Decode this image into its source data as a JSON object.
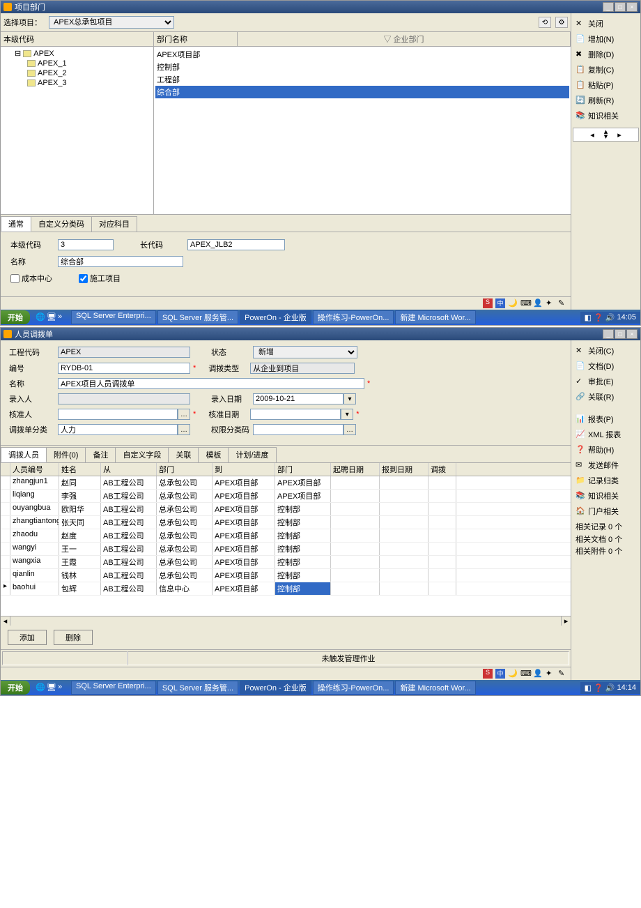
{
  "win1": {
    "title": "项目部门",
    "selectProjectLabel": "选择项目：",
    "selectProjectValue": "APEX总承包项目",
    "cols": {
      "code": "本级代码",
      "dept": "部门名称",
      "enterprise": "▽ 企业部门"
    },
    "tree": [
      {
        "code": "APEX",
        "dept": "APEX项目部",
        "level": 1,
        "expand": "⊟"
      },
      {
        "code": "APEX_1",
        "dept": "控制部",
        "level": 2
      },
      {
        "code": "APEX_2",
        "dept": "工程部",
        "level": 2
      },
      {
        "code": "APEX_3",
        "dept": "综合部",
        "level": 2,
        "sel": true
      }
    ],
    "tabs": [
      "通常",
      "自定义分类码",
      "对应科目"
    ],
    "form": {
      "localCodeLabel": "本级代码",
      "localCodeVal": "3",
      "longCodeLabel": "长代码",
      "longCodeVal": "APEX_JLB2",
      "nameLabel": "名称",
      "nameVal": "综合部",
      "costCenter": "成本中心",
      "consProject": "施工项目"
    },
    "side": [
      "关闭",
      "增加(N)",
      "删除(D)",
      "复制(C)",
      "粘贴(P)",
      "刷新(R)",
      "知识相关"
    ]
  },
  "win2": {
    "title": "人员调拨单",
    "form": {
      "engCodeLbl": "工程代码",
      "engCodeVal": "APEX",
      "statusLbl": "状态",
      "statusVal": "新增",
      "numLbl": "编号",
      "numVal": "RYDB-01",
      "typeL": "调拨类型",
      "typeVal": "从企业到项目",
      "nameLbl": "名称",
      "nameVal": "APEX项目人员调拨单",
      "inputLbl": "录入人",
      "inputDateLbl": "录入日期",
      "inputDateVal": "2009-10-21",
      "approveLbl": "核准人",
      "approveDateLbl": "核准日期",
      "catLbl": "调拨单分类",
      "catVal": "人力",
      "permCatLbl": "权限分类码"
    },
    "tabs": [
      "调拨人员",
      "附件(0)",
      "备注",
      "自定义字段",
      "关联",
      "模板",
      "计划/进度"
    ],
    "gridHeaders": [
      "人员编号",
      "姓名",
      "从",
      "部门",
      "到",
      "部门",
      "起聘日期",
      "报到日期",
      "调拨"
    ],
    "rows": [
      {
        "id": "zhangjun1",
        "name": "赵同",
        "from": "AB工程公司",
        "fd": "总承包公司",
        "to": "APEX项目部",
        "td": "APEX项目部"
      },
      {
        "id": "liqiang",
        "name": "李强",
        "from": "AB工程公司",
        "fd": "总承包公司",
        "to": "APEX项目部",
        "td": "APEX项目部"
      },
      {
        "id": "ouyangbua",
        "name": "欧阳华",
        "from": "AB工程公司",
        "fd": "总承包公司",
        "to": "APEX项目部",
        "td": "控制部"
      },
      {
        "id": "zhangtiantong",
        "name": "张天同",
        "from": "AB工程公司",
        "fd": "总承包公司",
        "to": "APEX项目部",
        "td": "控制部"
      },
      {
        "id": "zhaodu",
        "name": "赵度",
        "from": "AB工程公司",
        "fd": "总承包公司",
        "to": "APEX项目部",
        "td": "控制部"
      },
      {
        "id": "wangyi",
        "name": "王一",
        "from": "AB工程公司",
        "fd": "总承包公司",
        "to": "APEX项目部",
        "td": "控制部"
      },
      {
        "id": "wangxia",
        "name": "王霞",
        "from": "AB工程公司",
        "fd": "总承包公司",
        "to": "APEX项目部",
        "td": "控制部"
      },
      {
        "id": "qianlin",
        "name": "钱林",
        "from": "AB工程公司",
        "fd": "总承包公司",
        "to": "APEX项目部",
        "td": "控制部"
      },
      {
        "id": "baohui",
        "name": "包辉",
        "from": "AB工程公司",
        "fd": "信息中心",
        "to": "APEX项目部",
        "td": "控制部",
        "sel": true
      }
    ],
    "addBtn": "添加",
    "delBtn": "删除",
    "statusMsg": "未触发管理作业",
    "side": [
      "关闭(C)",
      "文档(D)",
      "审批(E)",
      "关联(R)"
    ],
    "side2": [
      "报表(P)",
      "XML 报表",
      "帮助(H)",
      "发送邮件",
      "记录归类",
      "知识相关",
      "门户相关"
    ],
    "stats": [
      "相关记录 0 个",
      "相关文档 0 个",
      "相关附件 0 个"
    ]
  },
  "taskbar": {
    "start": "开始",
    "items": [
      "SQL Server Enterpri...",
      "SQL Server 服务管...",
      "PowerOn - 企业版",
      "操作练习-PowerOn...",
      "新建 Microsoft Wor..."
    ],
    "time": "14:05",
    "time2": "14:14"
  }
}
